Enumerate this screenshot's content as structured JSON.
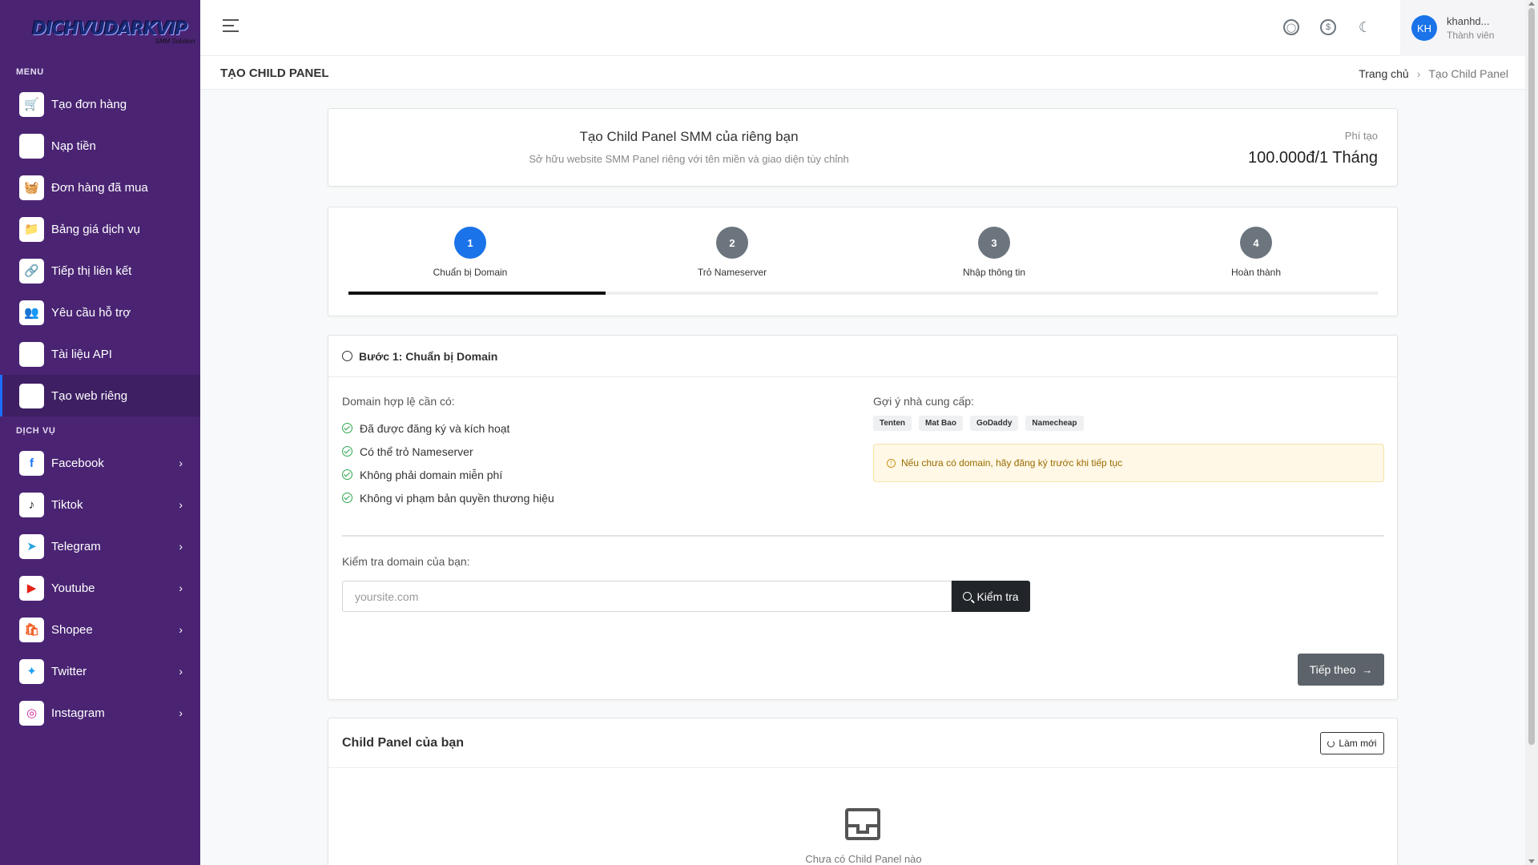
{
  "brand": {
    "logo_text": "DICHVUDARKVIP",
    "logo_sub": "SMM Solution"
  },
  "sidebar": {
    "menu_title": "MENU",
    "menu_items": [
      {
        "label": "Tạo đơn hàng",
        "icon": "🛒"
      },
      {
        "label": "Nạp tiền",
        "icon": "🏛"
      },
      {
        "label": "Đơn hàng đã mua",
        "icon": "🧺"
      },
      {
        "label": "Bảng giá dịch vụ",
        "icon": "📁"
      },
      {
        "label": "Tiếp thị liên kết",
        "icon": "🔗"
      },
      {
        "label": "Yêu cầu hỗ trợ",
        "icon": "👥"
      },
      {
        "label": "Tài liệu API",
        "icon": "⚙"
      },
      {
        "label": "Tạo web riêng",
        "icon": "▣"
      }
    ],
    "service_title": "DỊCH VỤ",
    "service_items": [
      {
        "label": "Facebook",
        "icon": "f",
        "color": "#1877f2"
      },
      {
        "label": "Tiktok",
        "icon": "♪",
        "color": "#111111"
      },
      {
        "label": "Telegram",
        "icon": "➤",
        "color": "#2aa3df"
      },
      {
        "label": "Youtube",
        "icon": "▶",
        "color": "#e62117"
      },
      {
        "label": "Shopee",
        "icon": "🛍",
        "color": "#f05d23"
      },
      {
        "label": "Twitter",
        "icon": "✦",
        "color": "#1da1f2"
      },
      {
        "label": "Instagram",
        "icon": "◎",
        "color": "#d6249f"
      }
    ]
  },
  "header": {
    "user_initials": "KH",
    "user_name": "khanhd...",
    "user_role": "Thành viên"
  },
  "page": {
    "title": "TẠO CHILD PANEL",
    "breadcrumb_home": "Trang chủ",
    "breadcrumb_current": "Tạo Child Panel"
  },
  "hero": {
    "title": "Tạo Child Panel SMM của riêng bạn",
    "subtitle": "Sở hữu website SMM Panel riêng với tên miền và giao diện tùy chỉnh",
    "fee_label": "Phí tạo",
    "fee_value": "100.000đ/1 Tháng"
  },
  "steps": {
    "items": [
      {
        "num": "1",
        "label": "Chuẩn bị Domain"
      },
      {
        "num": "2",
        "label": "Trỏ Nameserver"
      },
      {
        "num": "3",
        "label": "Nhập thông tin"
      },
      {
        "num": "4",
        "label": "Hoàn thành"
      }
    ],
    "progress_fraction": 0.25
  },
  "step1": {
    "title": "Bước 1: Chuẩn bị Domain",
    "requirements_label": "Domain hợp lệ cần có:",
    "requirements": [
      "Đã được đăng ký và kích hoạt",
      "Có thể trỏ Nameserver",
      "Không phải domain miễn phí",
      "Không vi phạm bản quyền thương hiệu"
    ],
    "providers_label": "Gợi ý nhà cung cấp:",
    "providers": [
      "Tenten",
      "Mat Bao",
      "GoDaddy",
      "Namecheap"
    ],
    "warning": "Nếu chưa có domain, hãy đăng ký trước khi tiếp tục",
    "check_label": "Kiểm tra domain của bạn:",
    "input_placeholder": "yoursite.com",
    "check_button": "Kiểm tra",
    "next_button": "Tiếp theo"
  },
  "child_panel": {
    "title": "Child Panel của bạn",
    "refresh_button": "Làm mới",
    "empty_text": "Chưa có Child Panel nào"
  }
}
